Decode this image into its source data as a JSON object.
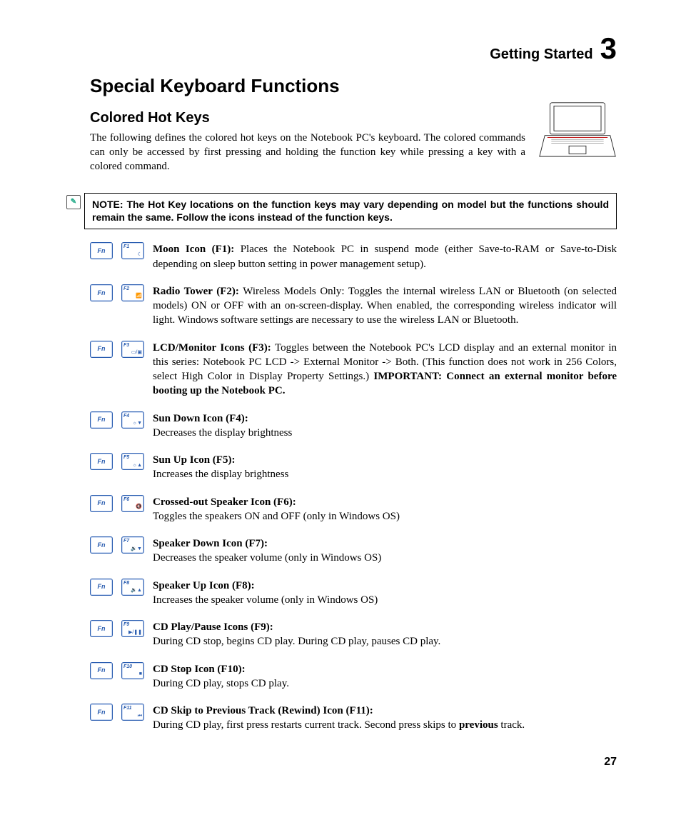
{
  "chapter": {
    "title": "Getting Started",
    "number": "3"
  },
  "h1": "Special Keyboard Functions",
  "h2": "Colored Hot Keys",
  "intro": "The following defines the colored hot keys on the Notebook PC's keyboard. The colored commands can only be accessed by first pressing and holding the function key while pressing a key with a colored command.",
  "note": "NOTE: The Hot Key locations on the function keys may vary depending on model but the functions should remain the same. Follow the icons instead of the function keys.",
  "fn_label": "Fn",
  "items": [
    {
      "key": "F1",
      "glyph": "☾",
      "label": "Moon Icon (F1):",
      "text": " Places the Notebook PC in suspend mode (either Save-to-RAM or Save-to-Disk depending on sleep button setting in power management setup)."
    },
    {
      "key": "F2",
      "glyph": "📶",
      "label": "Radio Tower (F2):",
      "text": " Wireless Models Only: Toggles the internal wireless LAN or Bluetooth (on selected models) ON or OFF with an on-screen-display. When enabled, the corresponding wireless indicator will light. Windows software settings are necessary to use the wireless LAN or Bluetooth."
    },
    {
      "key": "F3",
      "glyph": "▭/▣",
      "label": "LCD/Monitor Icons (F3):",
      "text": " Toggles between the Notebook PC's LCD display and an external monitor in this series: Notebook PC LCD -> External Monitor -> Both. (This function does not work in 256 Colors, select High Color in Display Property Settings.) ",
      "bold_tail": "IMPORTANT: Connect an external monitor before booting up the Notebook PC."
    },
    {
      "key": "F4",
      "glyph": "☼▼",
      "label": "Sun Down Icon (F4):",
      "text": "\nDecreases the display brightness"
    },
    {
      "key": "F5",
      "glyph": "☼▲",
      "label": "Sun Up Icon (F5):",
      "text": "\nIncreases the display brightness"
    },
    {
      "key": "F6",
      "glyph": "🔇",
      "label": "Crossed-out Speaker Icon (F6):",
      "text": "\nToggles the speakers ON and OFF (only in Windows OS)"
    },
    {
      "key": "F7",
      "glyph": "🔉▼",
      "label": "Speaker Down Icon (F7):",
      "text": "\nDecreases the speaker volume (only in Windows OS)"
    },
    {
      "key": "F8",
      "glyph": "🔉▲",
      "label": "Speaker Up Icon (F8):",
      "text": "\nIncreases the speaker volume (only in Windows OS)"
    },
    {
      "key": "F9",
      "glyph": "▶/❚❚",
      "label": "CD Play/Pause Icons (F9):",
      "text": "\nDuring CD stop, begins CD play. During CD play, pauses CD play."
    },
    {
      "key": "F10",
      "glyph": "■",
      "label": "CD Stop Icon (F10):",
      "text": "\nDuring CD play, stops CD play."
    },
    {
      "key": "F11",
      "glyph": "⏮",
      "label": "CD Skip to Previous Track (Rewind) Icon (F11):",
      "text": "\nDuring CD play, first press restarts current track. Second press skips to ",
      "bold_tail": "previous",
      "tail_after": " track."
    }
  ],
  "page_number": "27"
}
